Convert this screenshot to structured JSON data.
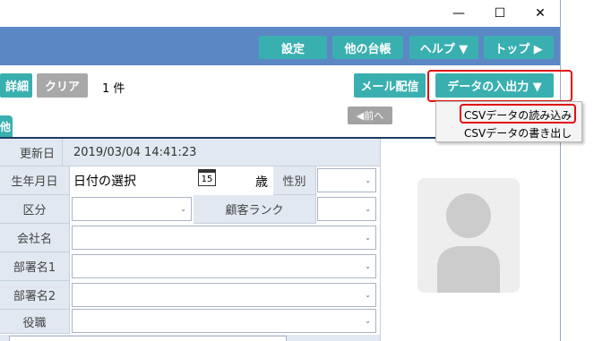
{
  "window": {
    "minimize_glyph": "—",
    "maximize_glyph": "☐",
    "close_glyph": "✕"
  },
  "header": {
    "settings_label": "設定",
    "other_ledger_label": "他の台帳",
    "help_label": "ヘルプ ▼",
    "top_label": "トップ ▶"
  },
  "toolbar": {
    "detail_label": "詳細",
    "clear_label": "クリア",
    "count_text": "1 件",
    "mail_label": "メール配信",
    "data_io_label": "データの入出力 ▼"
  },
  "nav": {
    "prev_label": "◀前へ"
  },
  "tab": {
    "label": "他"
  },
  "menu": {
    "items": [
      {
        "label": "CSVデータの読み込み"
      },
      {
        "label": "CSVデータの書き出し"
      }
    ]
  },
  "form": {
    "updated_label": "更新日",
    "updated_value": "2019/03/04 14:41:23",
    "birthday_label": "生年月日",
    "birthday_value": "日付の選択",
    "calendar_day": "15",
    "age_unit": "歳",
    "gender_label": "性別",
    "category_label": "区分",
    "rank_label": "顧客ランク",
    "company_label": "会社名",
    "dept1_label": "部署名1",
    "dept2_label": "部署名2",
    "position_label": "役職",
    "chevron_glyph": "⌄"
  },
  "colors": {
    "header": "#5b87c5",
    "teal_button": "#3aafb0",
    "gray_button": "#a8a8a8",
    "label_bg": "#e1e8f1",
    "highlight": "#e01010"
  }
}
